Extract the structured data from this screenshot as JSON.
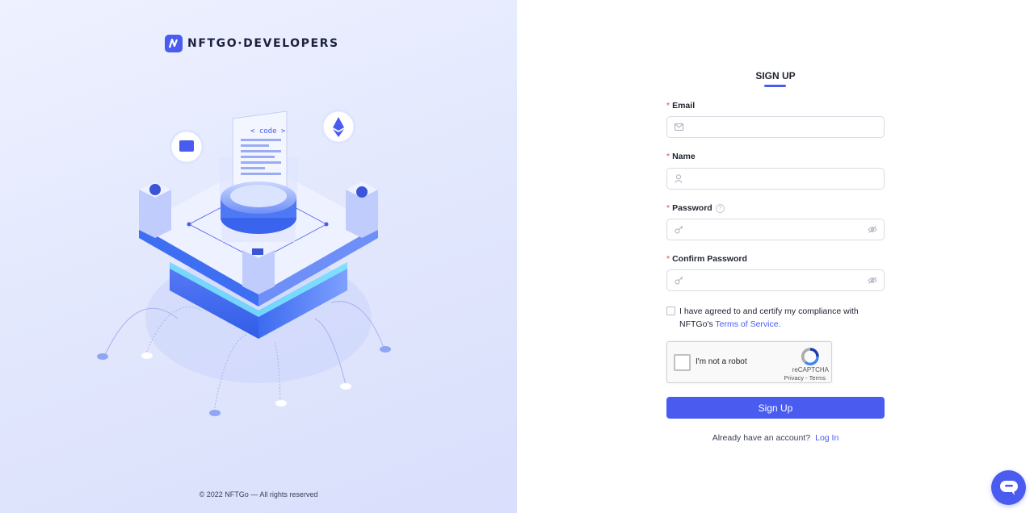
{
  "brand": {
    "logo_text": "NFTGO·DEVELOPERS"
  },
  "illustration": {
    "code_label": "< code >"
  },
  "footer": {
    "copyright": "© 2022 NFTGo — All rights reserved"
  },
  "form": {
    "title": "SIGN UP",
    "required_mark": "*",
    "email": {
      "label": "Email",
      "value": "",
      "placeholder": ""
    },
    "name": {
      "label": "Name",
      "value": "",
      "placeholder": ""
    },
    "password": {
      "label": "Password",
      "value": "",
      "placeholder": "",
      "help_icon": "question-circle-icon"
    },
    "confirm_password": {
      "label": "Confirm Password",
      "value": "",
      "placeholder": ""
    },
    "agreement": {
      "text": "I have agreed to and certify my compliance with NFTGo's",
      "link": "Terms of Service."
    },
    "captcha": {
      "label": "I'm not a robot",
      "brand": "reCAPTCHA",
      "links": "Privacy - Terms"
    },
    "submit_label": "Sign Up",
    "login_prompt": "Already have an account?",
    "login_link": "Log In"
  },
  "colors": {
    "accent": "#4a5cf0",
    "required": "#e34d4d"
  },
  "chat": {
    "icon": "chat-bubble-icon"
  }
}
